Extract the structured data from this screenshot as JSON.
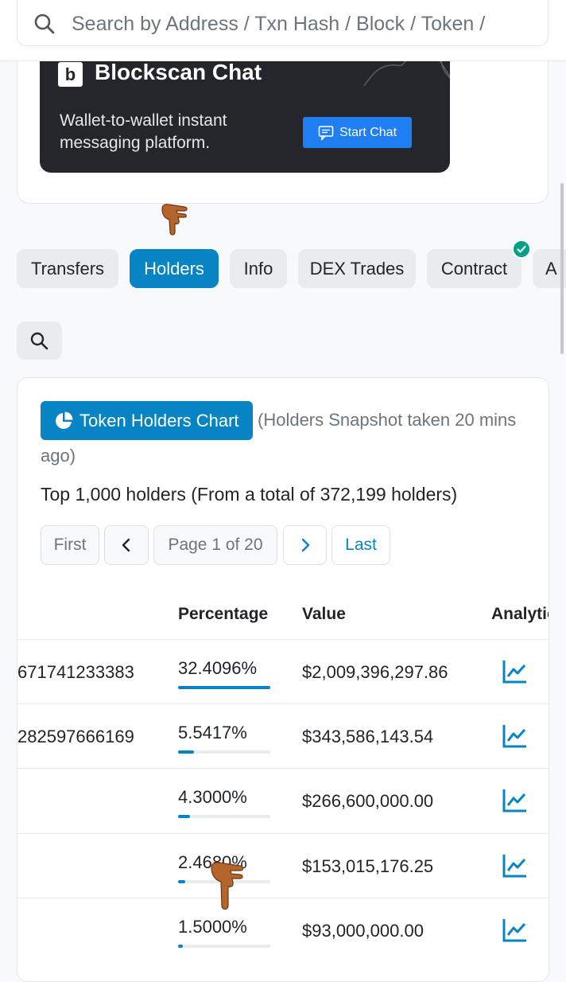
{
  "search": {
    "placeholder": "Search by Address / Txn Hash / Block / Token /"
  },
  "banner": {
    "logo_letter": "b",
    "title": "Blockscan Chat",
    "text": "Wallet-to-wallet instant messaging platform.",
    "button": "Start Chat"
  },
  "tabs": [
    "Transfers",
    "Holders",
    "Info",
    "DEX Trades",
    "Contract",
    "A"
  ],
  "active_tab": "Holders",
  "holders": {
    "chart_button": "Token Holders Chart",
    "snapshot_line1": "(Holders Snapshot taken 20 mins",
    "snapshot_line2": "ago)",
    "summary": "Top 1,000 holders (From a total of 372,199 holders)"
  },
  "pagination": {
    "first": "First",
    "page": "Page 1 of 20",
    "last": "Last"
  },
  "table": {
    "headers": {
      "percentage": "Percentage",
      "value": "Value",
      "analytics": "Analytics"
    },
    "rows": [
      {
        "address": "671741233383",
        "percentage": "32.4096%",
        "pct": 32.4096,
        "value": "$2,009,396,297.86"
      },
      {
        "address": "282597666169",
        "percentage": "5.5417%",
        "pct": 5.5417,
        "value": "$343,586,143.54"
      },
      {
        "address": "",
        "percentage": "4.3000%",
        "pct": 4.3,
        "value": "$266,600,000.00"
      },
      {
        "address": "",
        "percentage": "2.4680%",
        "pct": 2.468,
        "value": "$153,015,176.25"
      },
      {
        "address": "",
        "percentage": "1.5000%",
        "pct": 1.5,
        "value": "$93,000,000.00"
      }
    ]
  },
  "colors": {
    "accent": "#0784c3",
    "verified": "#00a186",
    "banner_bg": "#24262b",
    "start_chat": "#1f7ef2"
  }
}
